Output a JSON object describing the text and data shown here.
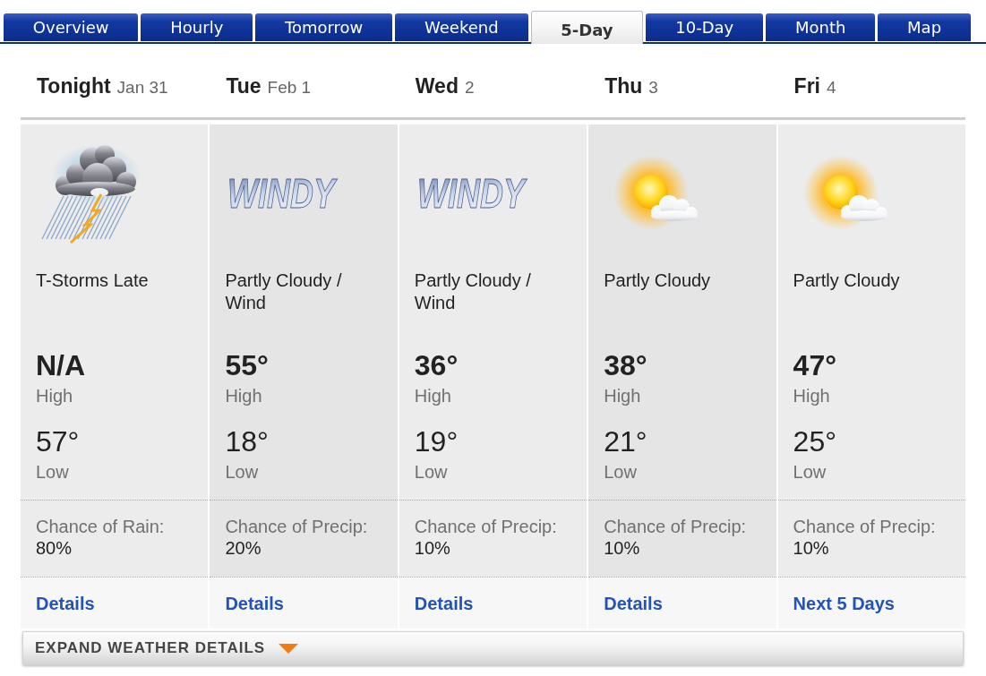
{
  "tabs": [
    {
      "label": "Overview",
      "selected": false
    },
    {
      "label": "Hourly",
      "selected": false
    },
    {
      "label": "Tomorrow",
      "selected": false
    },
    {
      "label": "Weekend",
      "selected": false
    },
    {
      "label": "5-Day",
      "selected": true
    },
    {
      "label": "10-Day",
      "selected": false
    },
    {
      "label": "Month",
      "selected": false
    },
    {
      "label": "Map",
      "selected": false
    }
  ],
  "days": [
    {
      "day": "Tonight",
      "date": "Jan 31",
      "icon": {
        "kind": "storm"
      },
      "condition": "T-Storms Late",
      "high": "N/A",
      "high_label": "High",
      "low": "57°",
      "low_label": "Low",
      "precip_label": "Chance of Rain:",
      "precip": "80%",
      "link": "Details"
    },
    {
      "day": "Tue",
      "date": "Feb 1",
      "icon": {
        "kind": "windy",
        "text": "WINDY"
      },
      "condition": "Partly Cloudy / Wind",
      "high": "55°",
      "high_label": "High",
      "low": "18°",
      "low_label": "Low",
      "precip_label": "Chance of Precip:",
      "precip": "20%",
      "link": "Details"
    },
    {
      "day": "Wed",
      "date": "2",
      "icon": {
        "kind": "windy",
        "text": "WINDY"
      },
      "condition": "Partly Cloudy / Wind",
      "high": "36°",
      "high_label": "High",
      "low": "19°",
      "low_label": "Low",
      "precip_label": "Chance of Precip:",
      "precip": "10%",
      "link": "Details"
    },
    {
      "day": "Thu",
      "date": "3",
      "icon": {
        "kind": "partly-sunny"
      },
      "condition": "Partly Cloudy",
      "high": "38°",
      "high_label": "High",
      "low": "21°",
      "low_label": "Low",
      "precip_label": "Chance of Precip:",
      "precip": "10%",
      "link": "Details"
    },
    {
      "day": "Fri",
      "date": "4",
      "icon": {
        "kind": "partly-sunny"
      },
      "condition": "Partly Cloudy",
      "high": "47°",
      "high_label": "High",
      "low": "25°",
      "low_label": "Low",
      "precip_label": "Chance of Precip:",
      "precip": "10%",
      "link": "Next 5 Days"
    }
  ],
  "expand_button": {
    "label": "EXPAND WEATHER DETAILS"
  }
}
